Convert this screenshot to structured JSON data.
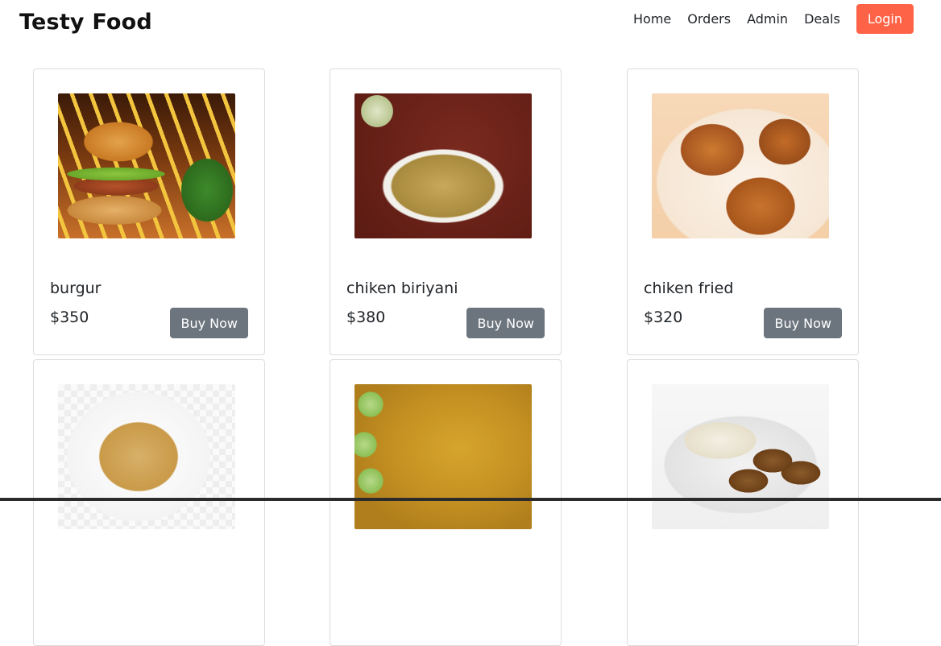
{
  "navbar": {
    "brand": "Testy Food",
    "links": [
      "Home",
      "Orders",
      "Admin",
      "Deals"
    ],
    "login_label": "Login"
  },
  "products": [
    {
      "name": "burgur",
      "price": "$350",
      "buy_label": "Buy Now"
    },
    {
      "name": "chiken biriyani",
      "price": "$380",
      "buy_label": "Buy Now"
    },
    {
      "name": "chiken fried",
      "price": "$320",
      "buy_label": "Buy Now"
    },
    {
      "name": "",
      "price": "",
      "buy_label": ""
    },
    {
      "name": "",
      "price": "",
      "buy_label": ""
    },
    {
      "name": "",
      "price": "",
      "buy_label": ""
    }
  ],
  "colors": {
    "login_button": "#ff6347",
    "buy_button": "#6c757d"
  }
}
